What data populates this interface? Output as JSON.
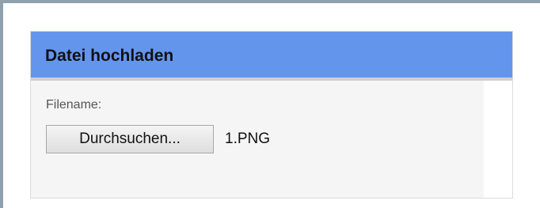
{
  "upload_panel": {
    "title": "Datei hochladen",
    "field_label": "Filename:",
    "browse_button_label": "Durchsuchen...",
    "selected_file": "1.PNG"
  },
  "colors": {
    "header_background": "#6495ed",
    "header_divider": "#cfcfcf",
    "body_background": "#f5f5f5",
    "outer_frame": "#8fa1ad"
  }
}
